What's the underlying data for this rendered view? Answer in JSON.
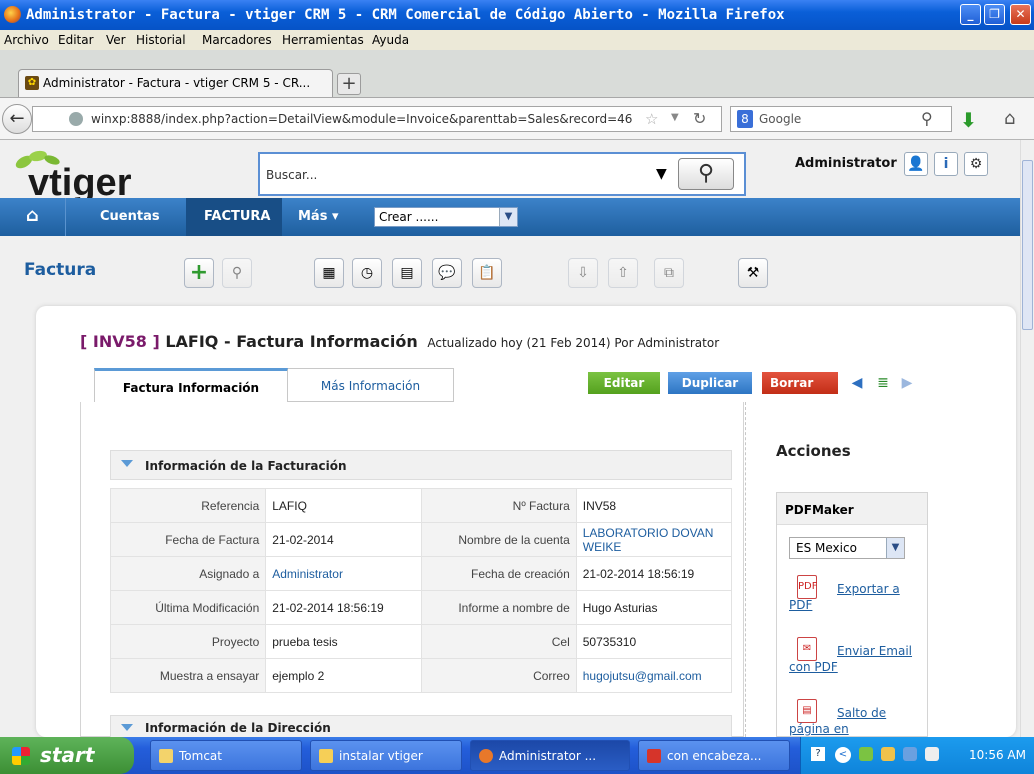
{
  "window": {
    "title": "Administrator - Factura - vtiger CRM 5 - CRM Comercial de Código Abierto - Mozilla Firefox"
  },
  "menu": [
    "Archivo",
    "Editar",
    "Ver",
    "Historial",
    "Marcadores",
    "Herramientas",
    "Ayuda"
  ],
  "browser_tab": {
    "label": "Administrator - Factura - vtiger CRM 5 - CR..."
  },
  "navbar": {
    "url": "winxp:8888/index.php?action=DetailView&module=Invoice&parenttab=Sales&record=46",
    "search_placeholder": "Google"
  },
  "header": {
    "logo": "vtiger",
    "search_placeholder": "Buscar...",
    "user": "Administrator"
  },
  "nav": {
    "items": [
      "Cuentas",
      "FACTURA",
      "Más ▾"
    ],
    "crear": "Crear ......"
  },
  "module": {
    "title": "Factura"
  },
  "record": {
    "id": "[ INV58 ]",
    "title": "LAFIQ - Factura Información",
    "updated": "Actualizado hoy (21 Feb 2014) Por Administrator"
  },
  "tabs": [
    "Factura Información",
    "Más Información"
  ],
  "actions": {
    "edit": "Editar",
    "duplicate": "Duplicar",
    "delete": "Borrar"
  },
  "billing": {
    "header": "Información de la Facturación",
    "rows": [
      {
        "l1": "Referencia",
        "v1": "LAFIQ",
        "l2": "Nº Factura",
        "v2": "INV58"
      },
      {
        "l1": "Fecha de Factura",
        "v1": "21-02-2014",
        "l2": "Nombre de la cuenta",
        "v2": "LABORATORIO DOVAN WEIKE"
      },
      {
        "l1": "Asignado a",
        "v1": "Administrator",
        "l2": "Fecha de creación",
        "v2": "21-02-2014 18:56:19"
      },
      {
        "l1": "Última Modificación",
        "v1": "21-02-2014 18:56:19",
        "l2": "Informe a nombre de",
        "v2": "Hugo Asturias"
      },
      {
        "l1": "Proyecto",
        "v1": "prueba tesis",
        "l2": "Cel",
        "v2": "50735310"
      },
      {
        "l1": "Muestra a ensayar",
        "v1": "ejemplo 2",
        "l2": "Correo",
        "v2": "hugojutsu@gmail.com"
      }
    ]
  },
  "address": {
    "header": "Información de la Dirección"
  },
  "sidebar": {
    "title": "Acciones",
    "panel": "PDFMaker",
    "language": "ES Mexico",
    "links": [
      "Exportar a PDF",
      "Enviar Email con PDF",
      "Salto de página en"
    ]
  },
  "taskbar": {
    "start": "start",
    "items": [
      "Tomcat",
      "instalar vtiger",
      "Administrator ...",
      "con encabeza..."
    ],
    "clock": "10:56 AM"
  }
}
